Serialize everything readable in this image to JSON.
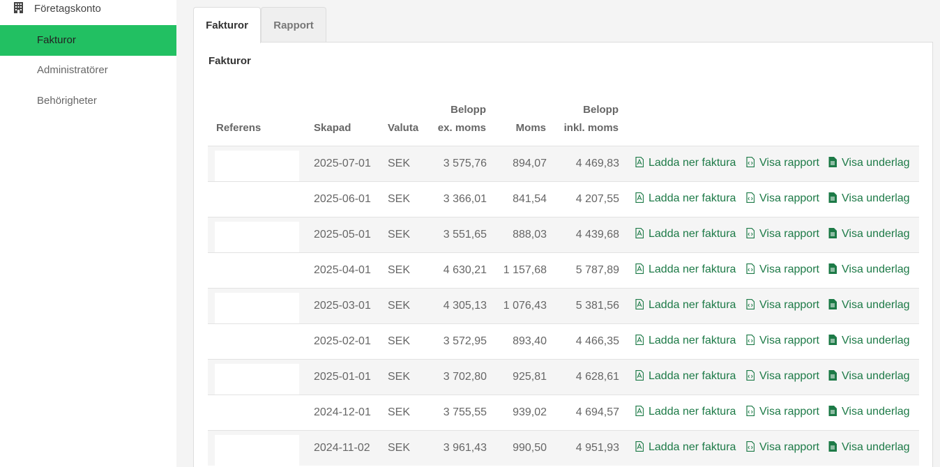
{
  "sidebar": {
    "section_label": "Företagskonto",
    "items": [
      {
        "label": "Fakturor",
        "active": true
      },
      {
        "label": "Administratörer",
        "active": false
      },
      {
        "label": "Behörigheter",
        "active": false
      }
    ]
  },
  "tabs": [
    {
      "label": "Fakturor",
      "active": true
    },
    {
      "label": "Rapport",
      "active": false
    }
  ],
  "panel": {
    "title": "Fakturor",
    "columns": {
      "referens": "Referens",
      "skapad": "Skapad",
      "valuta": "Valuta",
      "belopp_ex_1": "Belopp",
      "belopp_ex_2": "ex. moms",
      "moms": "Moms",
      "belopp_inkl_1": "Belopp",
      "belopp_inkl_2": "inkl. moms"
    },
    "actions": {
      "download": "Ladda ner faktura",
      "report": "Visa rapport",
      "underlag": "Visa underlag"
    },
    "rows": [
      {
        "skapad": "2025-07-01",
        "valuta": "SEK",
        "ex": "3 575,76",
        "moms": "894,07",
        "inkl": "4 469,83"
      },
      {
        "skapad": "2025-06-01",
        "valuta": "SEK",
        "ex": "3 366,01",
        "moms": "841,54",
        "inkl": "4 207,55"
      },
      {
        "skapad": "2025-05-01",
        "valuta": "SEK",
        "ex": "3 551,65",
        "moms": "888,03",
        "inkl": "4 439,68"
      },
      {
        "skapad": "2025-04-01",
        "valuta": "SEK",
        "ex": "4 630,21",
        "moms": "1 157,68",
        "inkl": "5 787,89"
      },
      {
        "skapad": "2025-03-01",
        "valuta": "SEK",
        "ex": "4 305,13",
        "moms": "1 076,43",
        "inkl": "5 381,56"
      },
      {
        "skapad": "2025-02-01",
        "valuta": "SEK",
        "ex": "3 572,95",
        "moms": "893,40",
        "inkl": "4 466,35"
      },
      {
        "skapad": "2025-01-01",
        "valuta": "SEK",
        "ex": "3 702,80",
        "moms": "925,81",
        "inkl": "4 628,61"
      },
      {
        "skapad": "2024-12-01",
        "valuta": "SEK",
        "ex": "3 755,55",
        "moms": "939,02",
        "inkl": "4 694,57"
      },
      {
        "skapad": "2024-11-02",
        "valuta": "SEK",
        "ex": "3 961,43",
        "moms": "990,50",
        "inkl": "4 951,93"
      }
    ]
  },
  "colors": {
    "accent": "#22c062",
    "link": "#1d7a47"
  },
  "icons": {
    "section": "building-icon",
    "download": "pdf-file-icon",
    "report": "code-file-icon",
    "underlag": "text-file-icon"
  }
}
